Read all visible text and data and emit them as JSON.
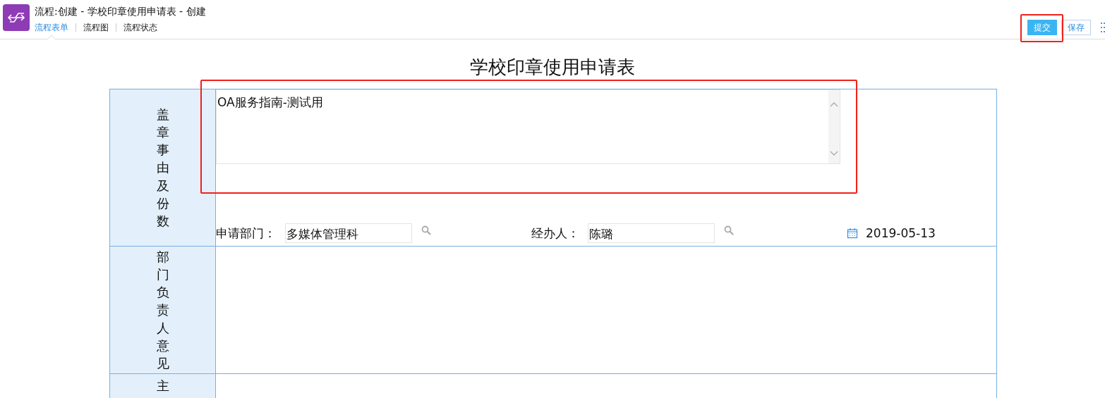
{
  "header": {
    "title": "流程:创建 - 学校印章使用申请表 - 创建",
    "tabs": [
      {
        "label": "流程表单",
        "selected": true
      },
      {
        "label": "流程图",
        "selected": false
      },
      {
        "label": "流程状态",
        "selected": false
      }
    ]
  },
  "actions": [
    {
      "label": "提交",
      "kind": "primary"
    },
    {
      "label": "保存",
      "kind": "secondary"
    }
  ],
  "form": {
    "title": "学校印章使用申请表",
    "rows": [
      {
        "label": "盖章事由及份数",
        "kind": "reason",
        "textarea": {
          "value": "OA服务指南-测试用"
        },
        "fields": [
          {
            "label": "申请部门：",
            "value": "多媒体管理科"
          },
          {
            "label": "经办人：",
            "value": "陈璐"
          }
        ],
        "date": "2019-05-13"
      },
      {
        "label": "部门负责人意见",
        "kind": "blank"
      },
      {
        "label": "主",
        "kind": "blank"
      }
    ]
  }
}
